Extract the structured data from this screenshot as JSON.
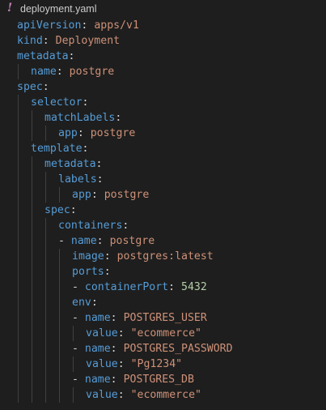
{
  "tab": {
    "icon": "!",
    "icon_name": "exclamation-icon",
    "filename": "deployment.yaml"
  },
  "colors": {
    "background": "#1e1e1e",
    "key": "#569cd6",
    "string": "#ce9178",
    "number": "#b5cea8",
    "punctuation": "#d4d4d4",
    "icon": "#c586c0"
  },
  "code": [
    {
      "indent": 0,
      "dash": "",
      "key": "apiVersion",
      "value": "apps/v1",
      "vtype": "s"
    },
    {
      "indent": 0,
      "dash": "",
      "key": "kind",
      "value": "Deployment",
      "vtype": "s"
    },
    {
      "indent": 0,
      "dash": "",
      "key": "metadata",
      "value": "",
      "vtype": "s"
    },
    {
      "indent": 1,
      "dash": "",
      "key": "name",
      "value": "postgre",
      "vtype": "s"
    },
    {
      "indent": 0,
      "dash": "",
      "key": "spec",
      "value": "",
      "vtype": "s"
    },
    {
      "indent": 1,
      "dash": "",
      "key": "selector",
      "value": "",
      "vtype": "s"
    },
    {
      "indent": 2,
      "dash": "",
      "key": "matchLabels",
      "value": "",
      "vtype": "s"
    },
    {
      "indent": 3,
      "dash": "",
      "key": "app",
      "value": "postgre",
      "vtype": "s"
    },
    {
      "indent": 1,
      "dash": "",
      "key": "template",
      "value": "",
      "vtype": "s"
    },
    {
      "indent": 2,
      "dash": "",
      "key": "metadata",
      "value": "",
      "vtype": "s"
    },
    {
      "indent": 3,
      "dash": "",
      "key": "labels",
      "value": "",
      "vtype": "s"
    },
    {
      "indent": 4,
      "dash": "",
      "key": "app",
      "value": "postgre",
      "vtype": "s"
    },
    {
      "indent": 2,
      "dash": "",
      "key": "spec",
      "value": "",
      "vtype": "s"
    },
    {
      "indent": 3,
      "dash": "",
      "key": "containers",
      "value": "",
      "vtype": "s"
    },
    {
      "indent": 3,
      "dash": "- ",
      "key": "name",
      "value": "postgre",
      "vtype": "s"
    },
    {
      "indent": 4,
      "dash": "",
      "key": "image",
      "value": "postgres:latest",
      "vtype": "s"
    },
    {
      "indent": 4,
      "dash": "",
      "key": "ports",
      "value": "",
      "vtype": "s"
    },
    {
      "indent": 4,
      "dash": "- ",
      "key": "containerPort",
      "value": "5432",
      "vtype": "n"
    },
    {
      "indent": 4,
      "dash": "",
      "key": "env",
      "value": "",
      "vtype": "s"
    },
    {
      "indent": 4,
      "dash": "- ",
      "key": "name",
      "value": "POSTGRES_USER",
      "vtype": "s"
    },
    {
      "indent": 5,
      "dash": "",
      "key": "value",
      "value": "\"ecommerce\"",
      "vtype": "s"
    },
    {
      "indent": 4,
      "dash": "- ",
      "key": "name",
      "value": "POSTGRES_PASSWORD",
      "vtype": "s"
    },
    {
      "indent": 5,
      "dash": "",
      "key": "value",
      "value": "\"Pg1234\"",
      "vtype": "s"
    },
    {
      "indent": 4,
      "dash": "- ",
      "key": "name",
      "value": "POSTGRES_DB",
      "vtype": "s"
    },
    {
      "indent": 5,
      "dash": "",
      "key": "value",
      "value": "\"ecommerce\"",
      "vtype": "s"
    }
  ]
}
